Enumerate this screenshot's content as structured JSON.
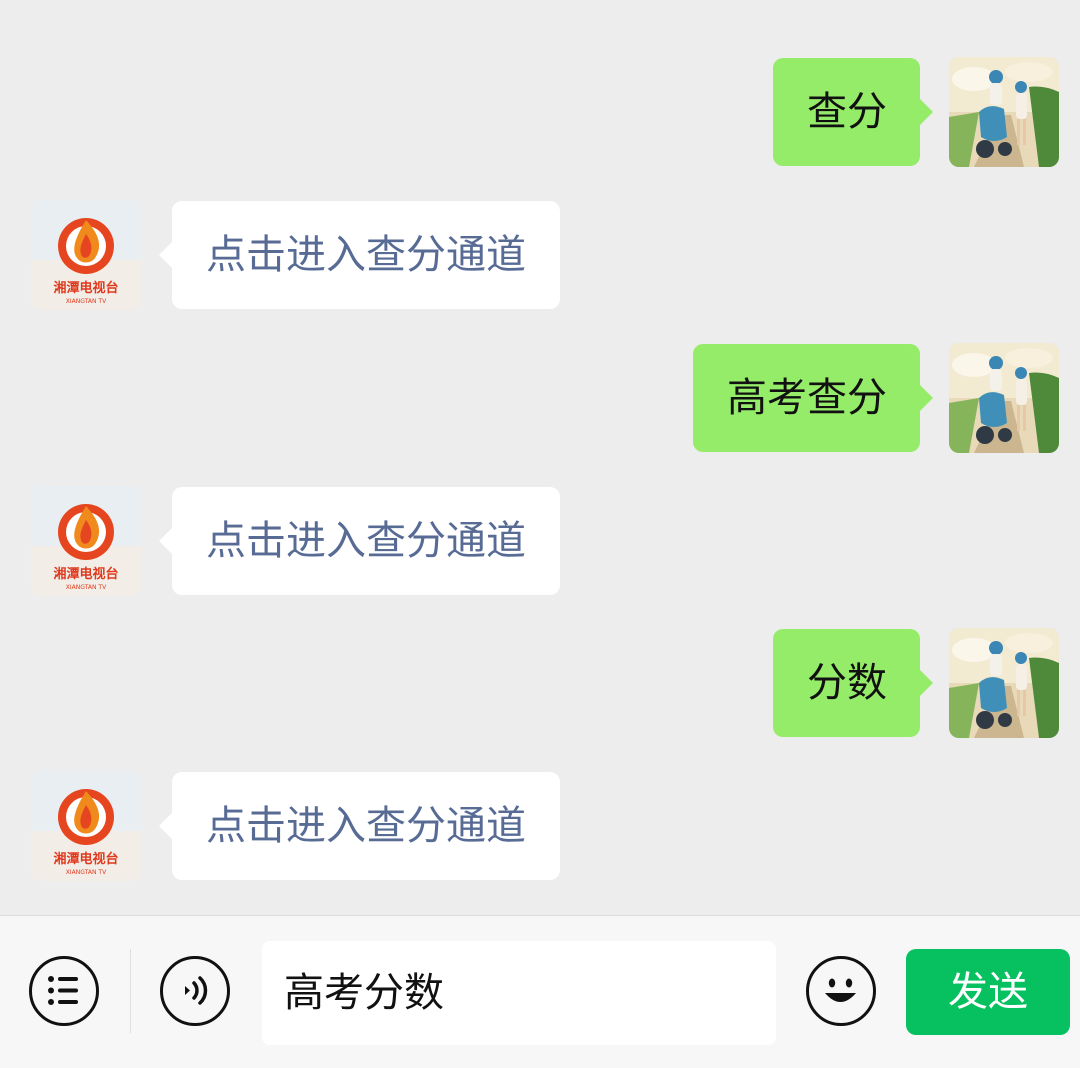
{
  "messages": [
    {
      "direction": "out",
      "text": "查分"
    },
    {
      "direction": "in",
      "text": "点击进入查分通道"
    },
    {
      "direction": "out",
      "text": "高考查分"
    },
    {
      "direction": "in",
      "text": "点击进入查分通道"
    },
    {
      "direction": "out",
      "text": "分数"
    },
    {
      "direction": "in",
      "text": "点击进入查分通道"
    }
  ],
  "official_account": {
    "logo_text": "湘潭电视台",
    "logo_subtext": "XIANGTAN TV",
    "logo_color": "#e03a1e"
  },
  "input_bar": {
    "menu_icon": "list-menu-icon",
    "voice_icon": "voice-icon",
    "draft_text": "高考分数",
    "emoji_icon": "emoji-icon",
    "send_label": "发送"
  },
  "colors": {
    "background": "#ededed",
    "outgoing_bubble": "#95ec69",
    "incoming_bubble": "#ffffff",
    "link_text": "#576b95",
    "send_button": "#07c160"
  }
}
